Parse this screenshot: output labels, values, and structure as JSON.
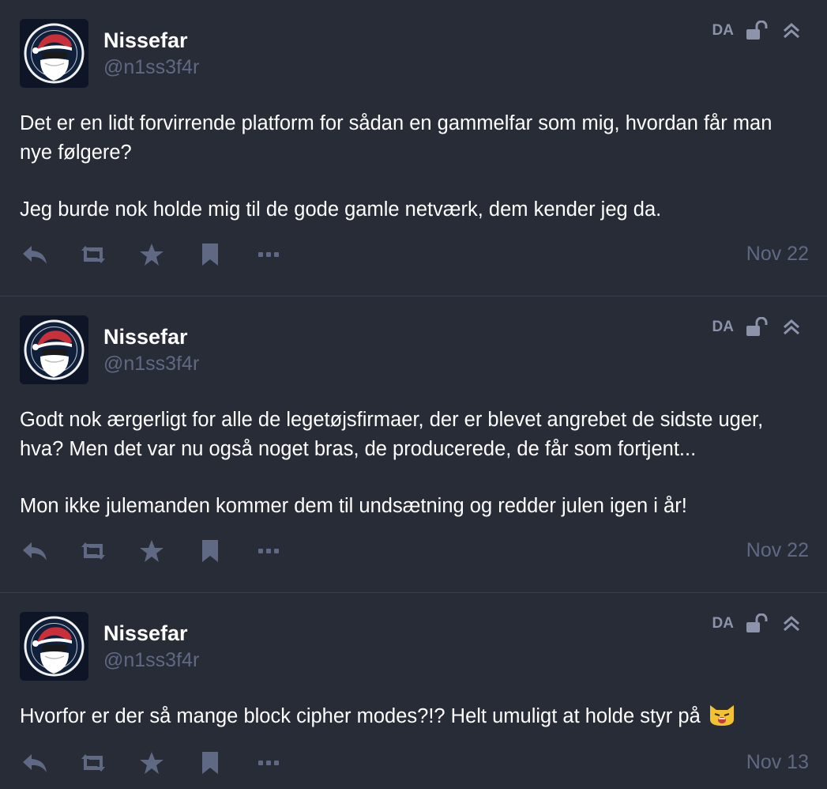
{
  "posts": [
    {
      "display_name": "Nissefar",
      "acct": "@n1ss3f4r",
      "language": "DA",
      "paragraphs": [
        "Det er en lidt forvirrende platform for sådan en gammelfar som mig, hvordan får man nye følgere?",
        "Jeg burde nok holde mig til de gode gamle netværk, dem kender jeg da."
      ],
      "date": "Nov 22"
    },
    {
      "display_name": "Nissefar",
      "acct": "@n1ss3f4r",
      "language": "DA",
      "paragraphs": [
        "Godt nok ærgerligt for alle de legetøjsfirmaer, der er blevet angrebet de sidste uger, hva? Men det var nu også noget bras, de producerede, de får som fortjent...",
        "Mon ikke julemanden kommer dem til undsætning og redder julen igen i år!"
      ],
      "date": "Nov 22"
    },
    {
      "display_name": "Nissefar",
      "acct": "@n1ss3f4r",
      "language": "DA",
      "paragraphs": [
        "Hvorfor er der så mange block cipher modes?!? Helt umuligt at holde styr på"
      ],
      "emoji": "angry-cat-emoji",
      "date": "Nov 13"
    }
  ],
  "icons": {
    "visibility": "unlock-icon",
    "collapse": "chevron-double-up-icon",
    "reply": "reply-icon",
    "boost": "retweet-icon",
    "favourite": "star-icon",
    "bookmark": "bookmark-icon",
    "more": "ellipsis-icon"
  },
  "colors": {
    "background": "#282c37",
    "muted": "#606984",
    "icon": "#8d93ab",
    "divider": "#393f4f"
  }
}
